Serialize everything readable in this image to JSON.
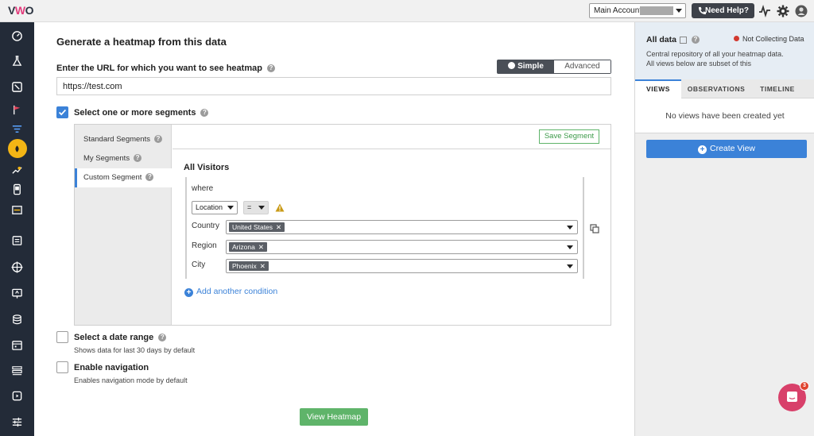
{
  "topbar": {
    "logo": "VWO",
    "account_label": "Main Account",
    "help_label": "Need Help?",
    "icons": [
      "pulse-icon",
      "gear-icon",
      "user-avatar-icon"
    ]
  },
  "leftnav": {
    "icons": [
      "dashboard-icon",
      "flask-icon",
      "insights-icon",
      "flag-icon",
      "funnel-icon",
      "heatmap-icon",
      "session-recording-icon",
      "mobile-icon",
      "form-icon",
      "calendar-list-icon",
      "target-icon",
      "deploy-icon",
      "database-icon",
      "calendar-icon",
      "list-icon",
      "integrations-icon",
      "sliders-icon"
    ]
  },
  "main": {
    "title": "Generate a heatmap from this data",
    "url_label": "Enter the URL for which you want to see heatmap",
    "mode_simple": "Simple",
    "mode_advanced": "Advanced",
    "url_value": "https://test.com",
    "segments_label": "Select one or more segments",
    "segment_tabs": [
      "Standard Segments",
      "My Segments",
      "Custom Segment"
    ],
    "save_segment": "Save Segment",
    "all_visitors": "All Visitors",
    "where": "where",
    "attribute": "Location",
    "operator": "=",
    "conditions": [
      {
        "label": "Country",
        "value": "United States"
      },
      {
        "label": "Region",
        "value": "Arizona"
      },
      {
        "label": "City",
        "value": "Phoenix"
      }
    ],
    "add_condition": "Add another condition",
    "date_range_label": "Select a date range",
    "date_range_sub": "Shows data for last 30 days by default",
    "nav_label": "Enable navigation",
    "nav_sub": "Enables navigation mode by default",
    "view_button": "View Heatmap"
  },
  "right": {
    "title": "All data",
    "status": "Not Collecting Data",
    "status_color": "#d2392f",
    "desc_1": "Central repository of all your heatmap data.",
    "desc_2": "All views below are subset of this",
    "tabs": [
      "VIEWS",
      "OBSERVATIONS",
      "TIMELINE"
    ],
    "empty": "No views have been created yet",
    "create": "Create View"
  },
  "chat": {
    "badge": "3"
  }
}
